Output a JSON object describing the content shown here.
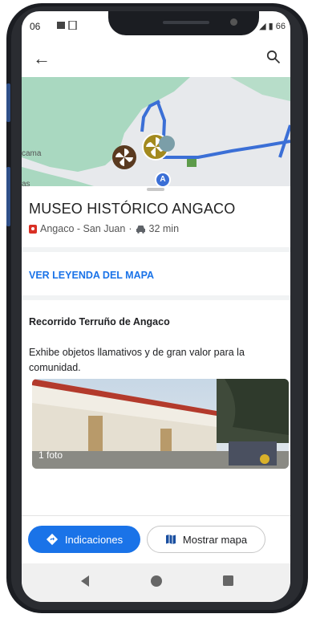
{
  "status_bar": {
    "time": "06",
    "right_text": "◢ ▮ 66"
  },
  "app_bar": {
    "back_icon": "arrow-back-icon",
    "search_icon": "search-icon"
  },
  "map": {
    "labels": [
      "cama",
      "as"
    ],
    "marker_letter": "A",
    "route_color": "#3b6fd6"
  },
  "place": {
    "title": "MUSEO HISTÓRICO ANGACO",
    "location": "Angaco - San Juan",
    "separator": "·",
    "travel_time": "32 min"
  },
  "legend_link": "VER LEYENDA DEL MAPA",
  "tour": {
    "title": "Recorrido Terruño de Angaco",
    "description": "Exhibe objetos llamativos y de gran valor para la comunidad.",
    "photo_count": "1 foto"
  },
  "actions": {
    "directions_label": "Indicaciones",
    "show_map_label": "Mostrar mapa"
  },
  "colors": {
    "accent": "#1a73e8",
    "pin": "#d93025"
  }
}
